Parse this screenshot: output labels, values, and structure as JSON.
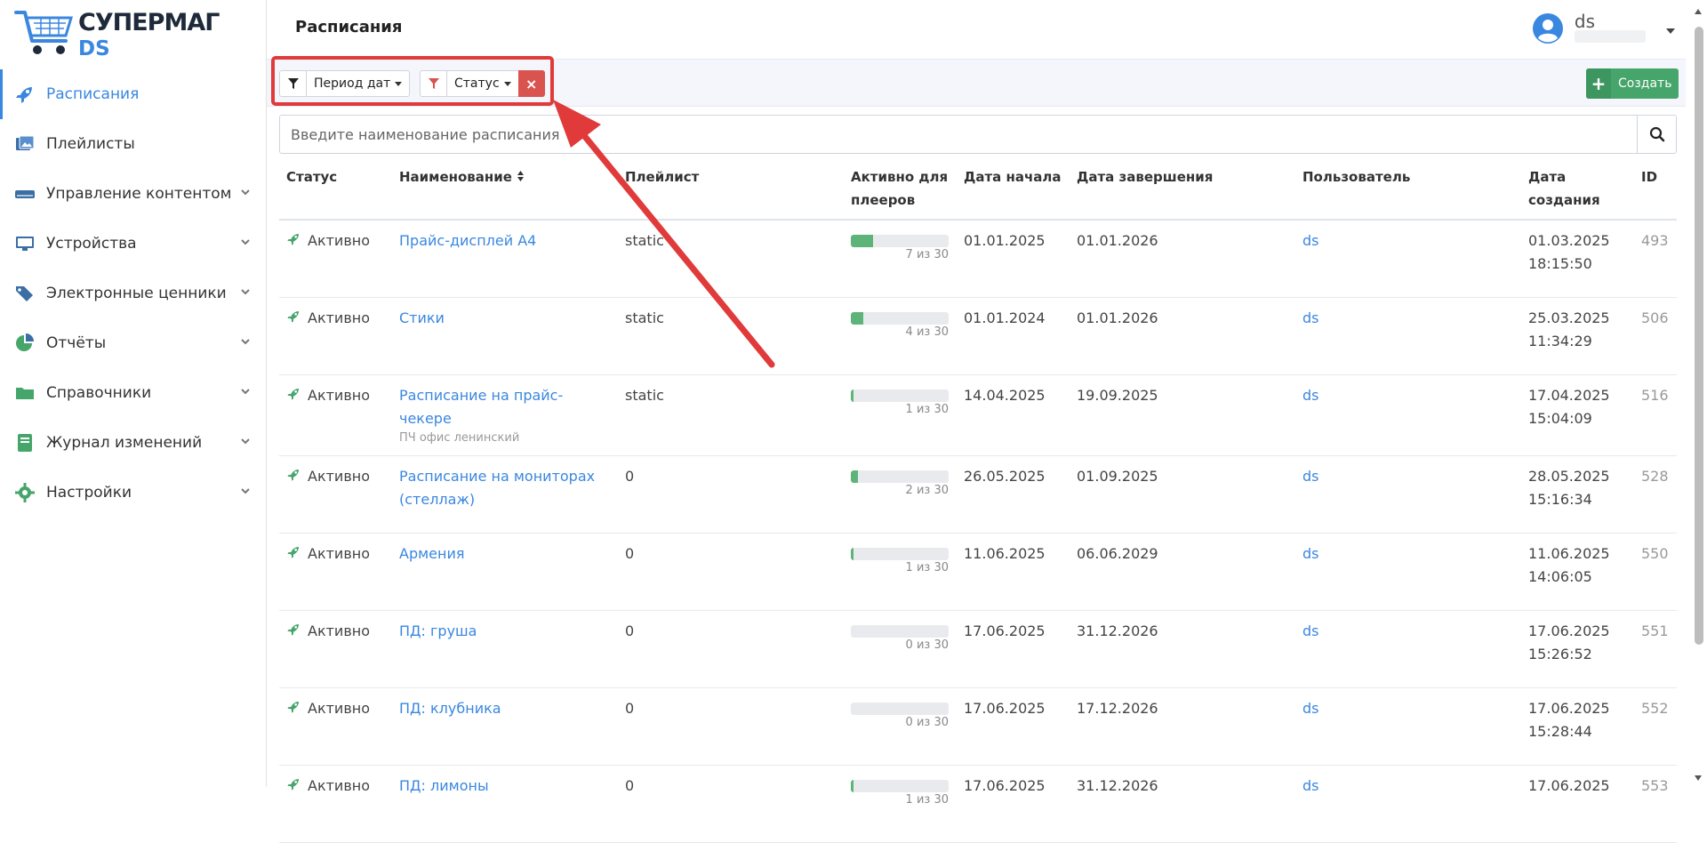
{
  "logo": {
    "line1": "СУПЕРМАГ",
    "line2": "DS"
  },
  "sidebar": {
    "items": [
      {
        "label": "Расписания",
        "icon": "rocket-icon",
        "active": true
      },
      {
        "label": "Плейлисты",
        "icon": "images-icon"
      },
      {
        "label": "Управление контентом",
        "icon": "server-icon",
        "chevron": true
      },
      {
        "label": "Устройства",
        "icon": "monitor-icon",
        "chevron": true
      },
      {
        "label": "Электронные ценники",
        "icon": "tags-icon",
        "chevron": true
      },
      {
        "label": "Отчёты",
        "icon": "pie-chart-icon",
        "chevron": true
      },
      {
        "label": "Справочники",
        "icon": "folder-icon",
        "chevron": true
      },
      {
        "label": "Журнал изменений",
        "icon": "book-icon",
        "chevron": true
      },
      {
        "label": "Настройки",
        "icon": "gear-icon",
        "chevron": true
      }
    ]
  },
  "header": {
    "title": "Расписания",
    "user": "ds"
  },
  "filters": {
    "period_label": "Период дат",
    "status_label": "Статус",
    "clear": "×"
  },
  "create_label": "Создать",
  "search": {
    "placeholder": "Введите наименование расписания"
  },
  "table": {
    "headers": [
      "Статус",
      "Наименование",
      "Плейлист",
      "Активно для плееров",
      "Дата начала",
      "Дата завершения",
      "Пользователь",
      "Дата создания",
      "ID"
    ],
    "rows": [
      {
        "status": "Активно",
        "name": "Прайс-дисплей А4",
        "sub": "",
        "playlist": "static",
        "active": 7,
        "total": 30,
        "progress": "7 из 30",
        "start": "01.01.2025",
        "end": "01.01.2026",
        "user": "ds",
        "created_date": "01.03.2025",
        "created_time": "18:15:50",
        "id": "493"
      },
      {
        "status": "Активно",
        "name": "Стики",
        "sub": "",
        "playlist": "static",
        "active": 4,
        "total": 30,
        "progress": "4 из 30",
        "start": "01.01.2024",
        "end": "01.01.2026",
        "user": "ds",
        "created_date": "25.03.2025",
        "created_time": "11:34:29",
        "id": "506"
      },
      {
        "status": "Активно",
        "name": "Расписание на прайс-чекере",
        "sub": "ПЧ офис ленинский",
        "playlist": "static",
        "active": 1,
        "total": 30,
        "progress": "1 из 30",
        "start": "14.04.2025",
        "end": "19.09.2025",
        "user": "ds",
        "created_date": "17.04.2025",
        "created_time": "15:04:09",
        "id": "516"
      },
      {
        "status": "Активно",
        "name": "Расписание на мониторах (стеллаж)",
        "sub": "",
        "playlist": "0",
        "active": 2,
        "total": 30,
        "progress": "2 из 30",
        "start": "26.05.2025",
        "end": "01.09.2025",
        "user": "ds",
        "created_date": "28.05.2025",
        "created_time": "15:16:34",
        "id": "528"
      },
      {
        "status": "Активно",
        "name": "Армения",
        "sub": "",
        "playlist": "0",
        "active": 1,
        "total": 30,
        "progress": "1 из 30",
        "start": "11.06.2025",
        "end": "06.06.2029",
        "user": "ds",
        "created_date": "11.06.2025",
        "created_time": "14:06:05",
        "id": "550"
      },
      {
        "status": "Активно",
        "name": "ПД: груша",
        "sub": "",
        "playlist": "0",
        "active": 0,
        "total": 30,
        "progress": "0 из 30",
        "start": "17.06.2025",
        "end": "31.12.2026",
        "user": "ds",
        "created_date": "17.06.2025",
        "created_time": "15:26:52",
        "id": "551"
      },
      {
        "status": "Активно",
        "name": "ПД: клубника",
        "sub": "",
        "playlist": "0",
        "active": 0,
        "total": 30,
        "progress": "0 из 30",
        "start": "17.06.2025",
        "end": "17.12.2026",
        "user": "ds",
        "created_date": "17.06.2025",
        "created_time": "15:28:44",
        "id": "552"
      },
      {
        "status": "Активно",
        "name": "ПД: лимоны",
        "sub": "",
        "playlist": "0",
        "active": 1,
        "total": 30,
        "progress": "1 из 30",
        "start": "17.06.2025",
        "end": "31.12.2026",
        "user": "ds",
        "created_date": "17.06.2025",
        "created_time": "",
        "id": "553"
      }
    ]
  },
  "colors": {
    "accent": "#3a87e0",
    "success": "#46a56a",
    "danger": "#d9534f",
    "annotation": "#e03a3a"
  }
}
